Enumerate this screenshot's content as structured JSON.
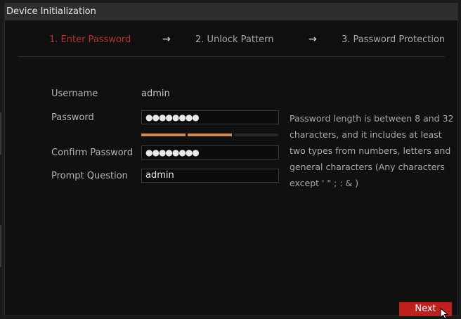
{
  "window": {
    "title": "Device Initialization"
  },
  "steps": [
    {
      "label": "1.  Enter Password",
      "active": true
    },
    {
      "label": "2.  Unlock Pattern",
      "active": false
    },
    {
      "label": "3.  Password Protection",
      "active": false
    }
  ],
  "step_arrow": "→",
  "form": {
    "username_label": "Username",
    "username_value": "admin",
    "password_label": "Password",
    "password_value": "●●●●●●●●",
    "confirm_label": "Confirm Password",
    "confirm_value": "●●●●●●●●",
    "prompt_label": "Prompt Question",
    "prompt_value": "admin",
    "strength_level": 0.67
  },
  "hint": "Password length is between 8 and 32 characters, and it includes at least two  types from numbers, letters and general characters (Any characters except  ' \" ; : & )",
  "buttons": {
    "next_label": "Next"
  },
  "colors": {
    "accent": "#c0201c",
    "strength": "#d08a4e",
    "active_step": "#c0302a"
  }
}
